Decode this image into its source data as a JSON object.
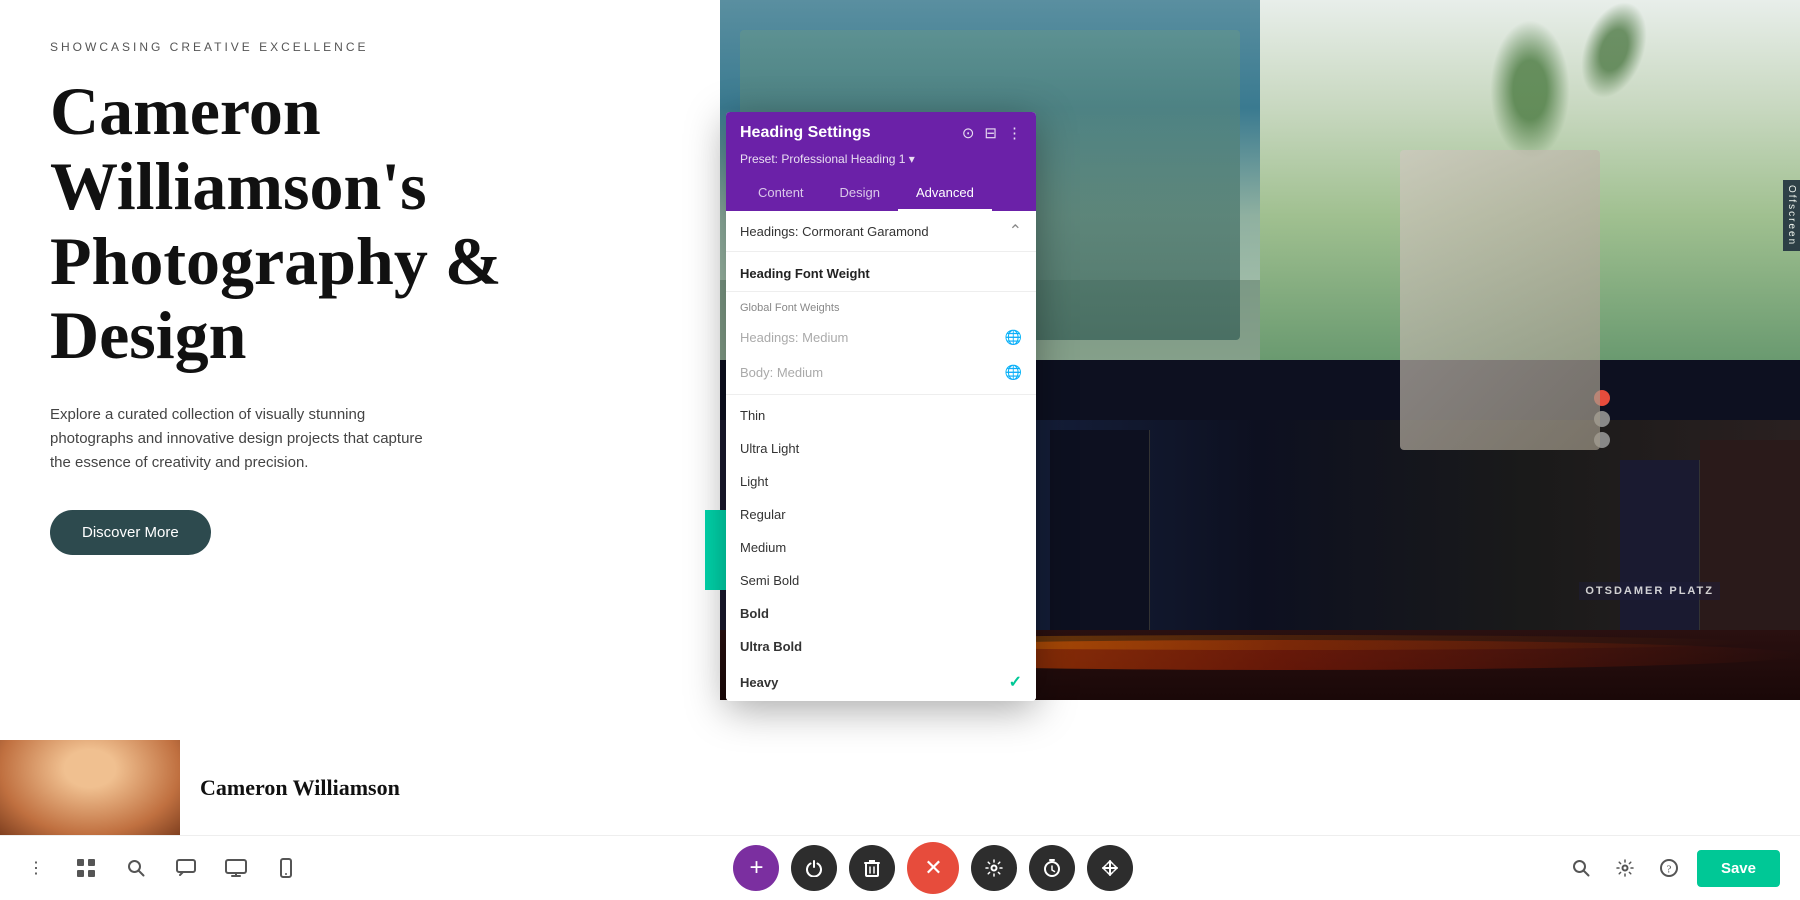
{
  "site": {
    "subtitle": "SHOWCASING CREATIVE EXCELLENCE",
    "title": "Cameron Williamson's Photography & Design",
    "description": "Explore a curated collection of visually stunning photographs and innovative design projects that capture the essence of creativity and precision.",
    "cta_button": "Discover More"
  },
  "panel": {
    "title": "Heading Settings",
    "preset": "Preset: Professional Heading 1 ▾",
    "tabs": [
      "Content",
      "Design",
      "Advanced"
    ],
    "active_tab": "Advanced",
    "font_row_label": "Headings: Cormorant Garamond",
    "section_title": "Heading Font Weight",
    "font_weights": {
      "global_group": "Global Font Weights",
      "headings_global": "Headings: Medium",
      "body_global": "Body: Medium",
      "options": [
        "Thin",
        "Ultra Light",
        "Light",
        "Regular",
        "Medium",
        "Semi Bold",
        "Bold",
        "Ultra Bold",
        "Heavy"
      ],
      "selected": "Heavy"
    }
  },
  "bottom_bar": {
    "left_icons": [
      "⋮",
      "⊞",
      "⌕",
      "💬",
      "▭",
      "📱"
    ],
    "center_buttons": [
      {
        "label": "+",
        "style": "purple"
      },
      {
        "label": "⏻",
        "style": "dark"
      },
      {
        "label": "🗑",
        "style": "dark"
      },
      {
        "label": "✕",
        "style": "red"
      },
      {
        "label": "⚙",
        "style": "dark"
      },
      {
        "label": "⏱",
        "style": "dark"
      },
      {
        "label": "⇕",
        "style": "dark"
      }
    ],
    "right_icons": [
      "🔍",
      "⚙",
      "?"
    ],
    "save_label": "Save"
  },
  "colors": {
    "purple": "#6b21a8",
    "teal": "#00c896",
    "dark": "#2d2d2d",
    "red": "#e74c3c"
  },
  "offscreen_label": "Offscreen"
}
